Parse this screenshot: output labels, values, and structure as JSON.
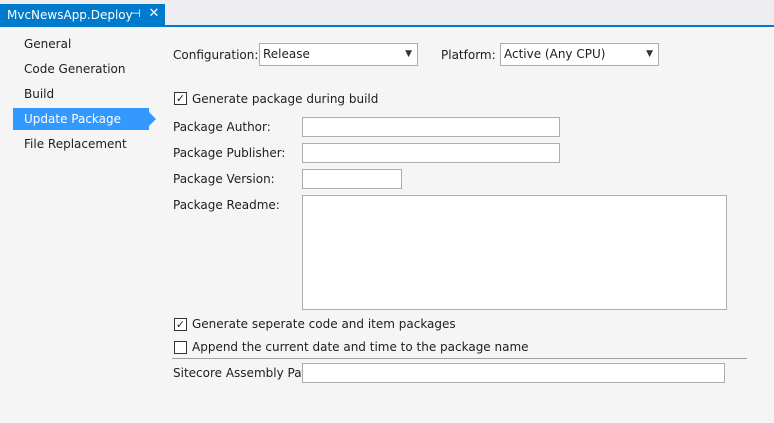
{
  "tab": {
    "title": "MvcNewsApp.Deploy",
    "pin_icon": "pin-icon",
    "close_icon": "close-icon"
  },
  "sidebar": {
    "items": [
      {
        "label": "General"
      },
      {
        "label": "Code Generation"
      },
      {
        "label": "Build"
      },
      {
        "label": "Update Package",
        "active": true
      },
      {
        "label": "File Replacement"
      }
    ]
  },
  "configuration": {
    "label": "Configuration:",
    "value": "Release"
  },
  "platform": {
    "label": "Platform:",
    "value": "Active (Any CPU)"
  },
  "generate_package": {
    "label": "Generate package during build",
    "checked": true
  },
  "package_author": {
    "label": "Package Author:",
    "value": ""
  },
  "package_publisher": {
    "label": "Package Publisher:",
    "value": ""
  },
  "package_version": {
    "label": "Package Version:",
    "value": ""
  },
  "package_readme": {
    "label": "Package Readme:",
    "value": ""
  },
  "separate_packages": {
    "label": "Generate seperate code and item packages",
    "checked": true
  },
  "append_date": {
    "label": "Append the current date and time to the package name",
    "checked": false
  },
  "assembly_path": {
    "label": "Sitecore Assembly Path:",
    "value": ""
  },
  "accent_color": "#007acc",
  "selection_color": "#3399ff"
}
